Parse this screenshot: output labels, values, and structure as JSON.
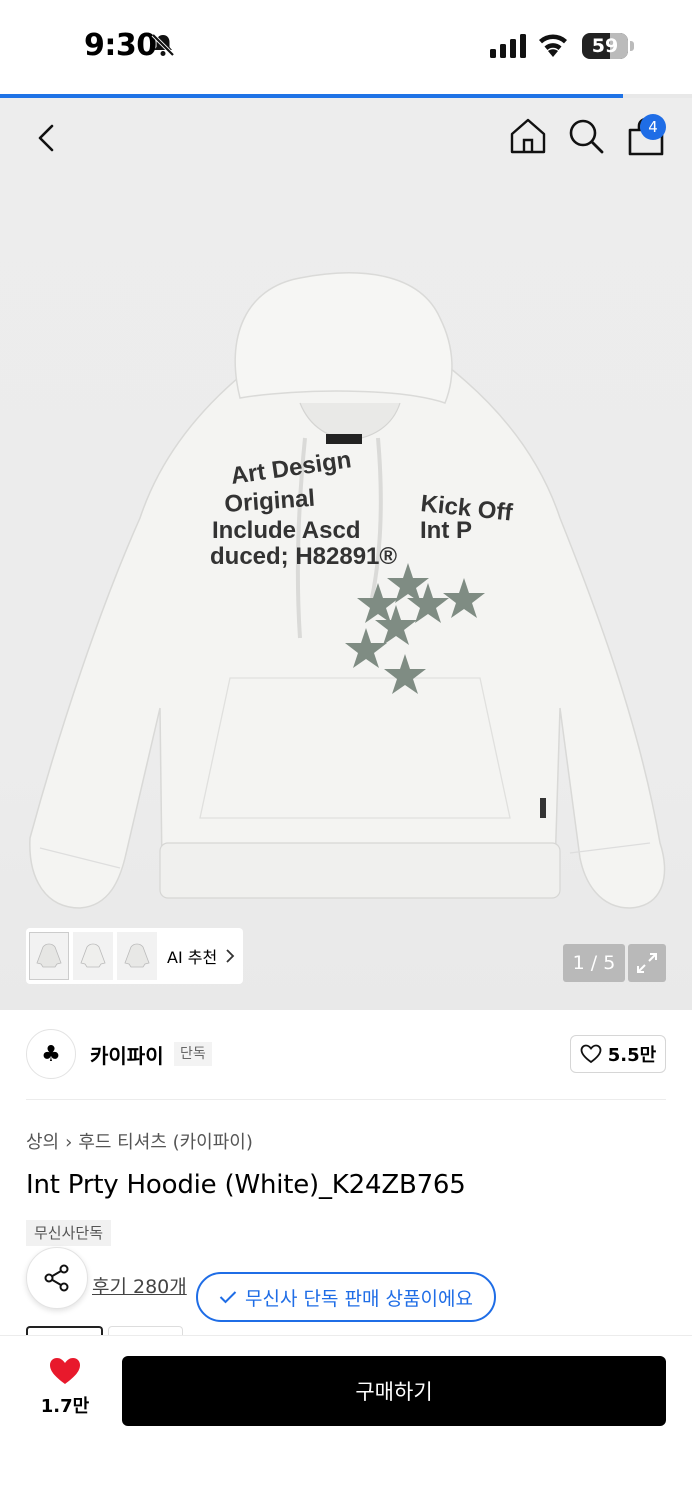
{
  "status_bar": {
    "time": "9:30",
    "battery": "59"
  },
  "page_progress": 0.9,
  "header": {
    "cart_count": "4"
  },
  "gallery": {
    "ai_label": "AI 추천",
    "pager": "1 / 5",
    "print_text": [
      "Art Design",
      "Original",
      "Include Ascd",
      "duced; H82891®",
      "Kick Off",
      "Int P"
    ]
  },
  "brand": {
    "logo_symbol": "♣",
    "name": "카이파이",
    "tag": "단독",
    "likes": "5.5만"
  },
  "product": {
    "breadcrumb": [
      "상의",
      "후드 티셔츠 (카이파이)"
    ],
    "title": "Int Prty Hoodie (White)_K24ZB765",
    "exclusive_tag": "무신사단독",
    "reviews": "후기 280개",
    "exclusive_notice": "무신사 단독 판매 상품이에요"
  },
  "bottom_bar": {
    "wishlist_count": "1.7만",
    "buy_label": "구매하기"
  },
  "colors": {
    "accent": "#1f6de6",
    "heart": "#e8192c",
    "star": "#7f8c83"
  }
}
